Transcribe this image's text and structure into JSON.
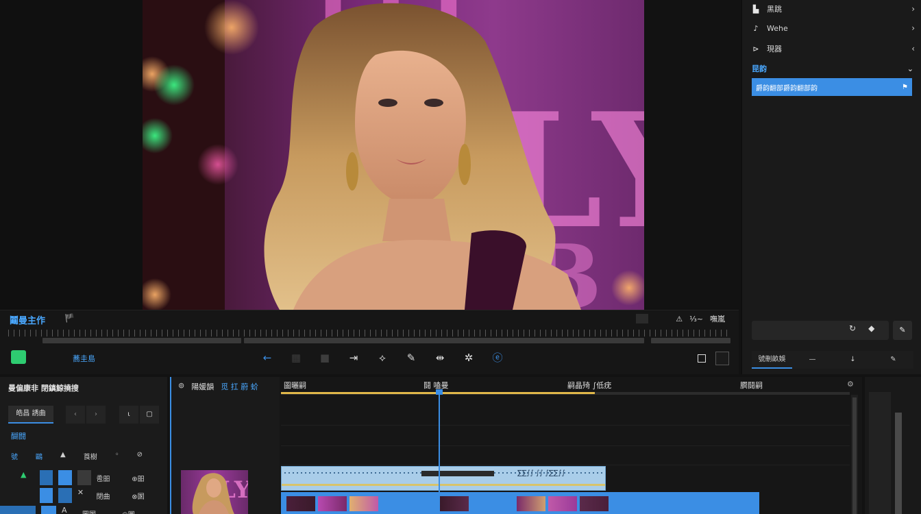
{
  "inspector": {
    "rows": [
      {
        "icon": "media-icon",
        "glyph": "▙",
        "label": "黑跳",
        "chev": "›"
      },
      {
        "icon": "audio-icon",
        "glyph": "♪",
        "label": "Wehe",
        "chev": "›"
      },
      {
        "icon": "cursor-icon",
        "glyph": "⊳",
        "label": "現器",
        "chev": "‹"
      }
    ],
    "section_title": "昆韵",
    "section_chev": "⌄",
    "selected_item": "爵韵翻部爵韵翻部韵",
    "tabs": [
      "號刪畝娛",
      "—",
      "↓",
      "✎"
    ]
  },
  "transport": {
    "title": "鬮曼主作",
    "flag": "🏴",
    "right_label": "嘸嵐",
    "right_mid": "⅓~",
    "left_label": "蕎圭島",
    "tools": [
      {
        "name": "back-arrow-icon",
        "glyph": "←",
        "tone": "blue"
      },
      {
        "name": "grid-icon",
        "glyph": "▦",
        "tone": "dim"
      },
      {
        "name": "stop-icon",
        "glyph": "■",
        "tone": "dim"
      },
      {
        "name": "forward-arrow-icon",
        "glyph": "⇥",
        "tone": "normal"
      },
      {
        "name": "trim-icon",
        "glyph": "⟡",
        "tone": "normal"
      },
      {
        "name": "pen-icon",
        "glyph": "✎",
        "tone": "normal"
      },
      {
        "name": "split-icon",
        "glyph": "⇹",
        "tone": "normal"
      },
      {
        "name": "effects-icon",
        "glyph": "✲",
        "tone": "normal"
      },
      {
        "name": "browser-icon",
        "glyph": "ⓔ",
        "tone": "blue"
      }
    ]
  },
  "library": {
    "title": "曼偏康非 閉鎮鯨撓搜",
    "button": "皓昌 誘曲",
    "sub": "醐闘",
    "cols": [
      "號",
      "鷗",
      "▲",
      "莨樹",
      "◦",
      "⊘"
    ],
    "grid_labels": [
      "卺昍",
      "閉曲",
      "圖圂"
    ],
    "grid_side": [
      "⊕昍",
      "⊗圂",
      "◎圓"
    ]
  },
  "timeline": {
    "tab_a": "陽媛韻",
    "tab_b": "觅 扛 蔚 蚧",
    "labels": [
      "圖曬嗣",
      "鬪 嗑曼",
      "嗣晶㱦 ∫低疣",
      "膶鬪嗣"
    ],
    "audio_clip_label": "∑∑∫∫ ∫∫ ∫∑∑∫∫"
  },
  "colors": {
    "accent": "#3b8ee4",
    "selection": "#3b8ee4",
    "green": "#2ecc71",
    "yellow": "#e1b84a",
    "flag": "#ff7a3d"
  }
}
